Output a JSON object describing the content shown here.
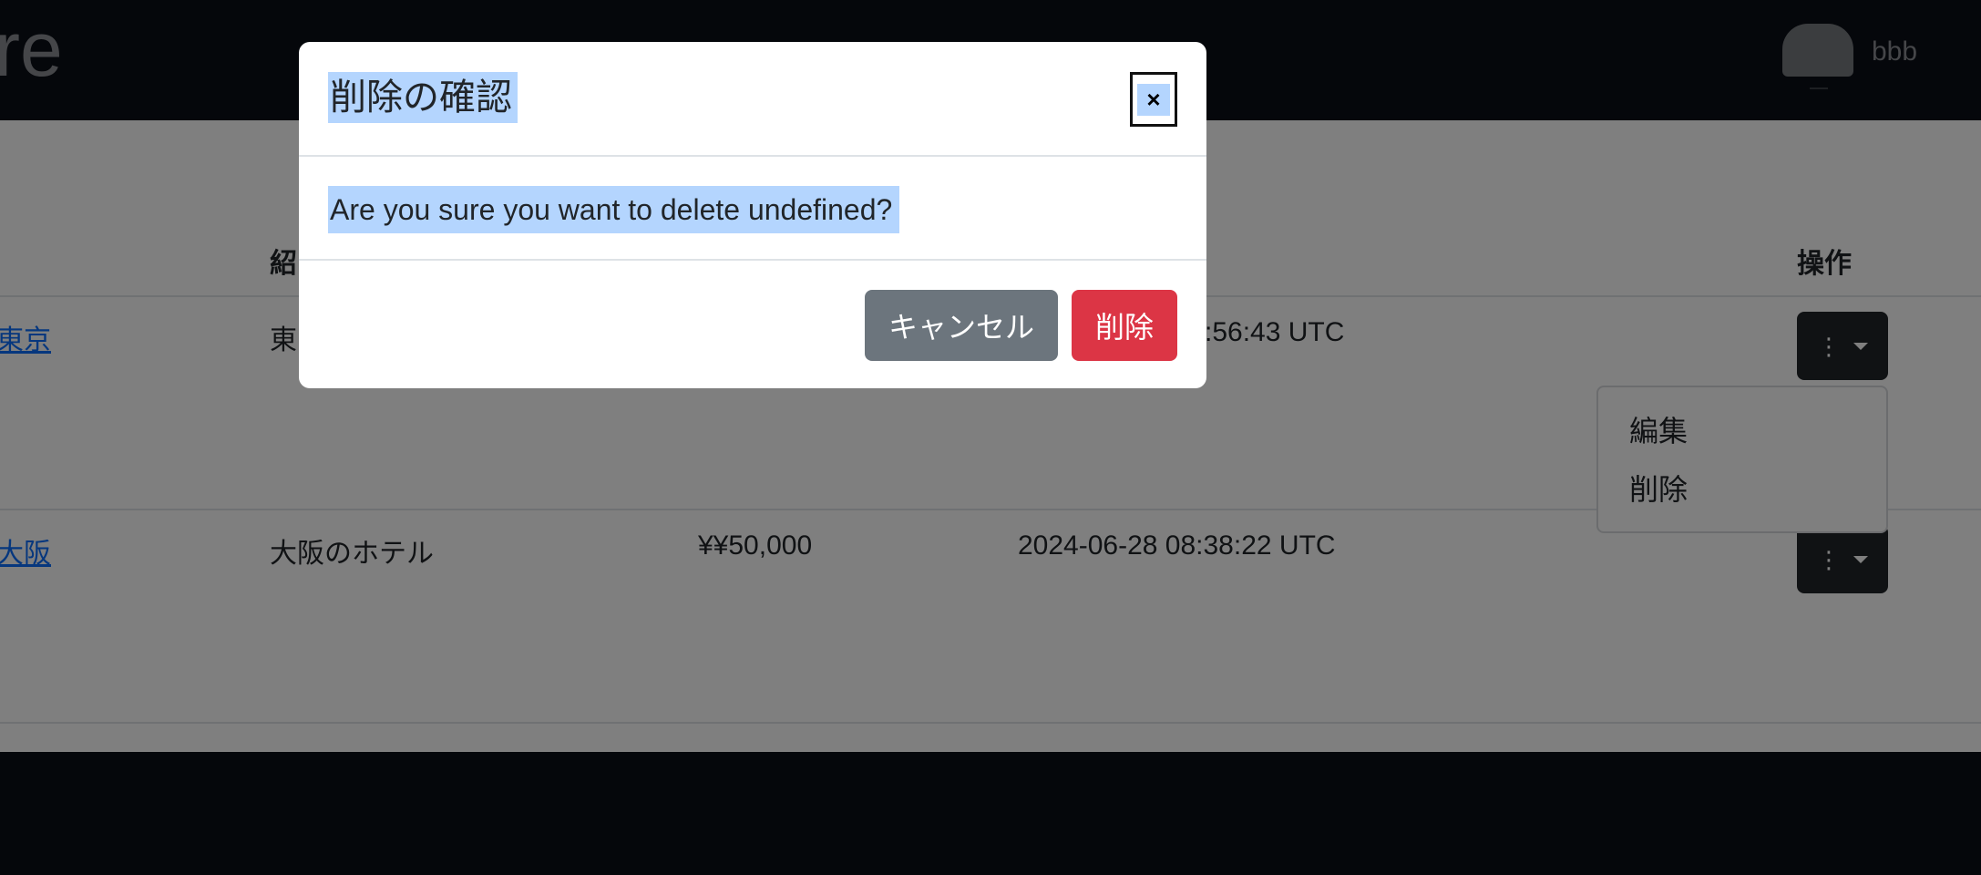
{
  "header": {
    "brand_fragment": "re",
    "username": "bbb"
  },
  "table": {
    "headers": {
      "description": "紹",
      "actions": "操作"
    },
    "rows": [
      {
        "name": "東京",
        "description": "東",
        "created_at": ":56:43 UTC"
      },
      {
        "name": "大阪",
        "description": "大阪のホテル",
        "price": "¥¥50,000",
        "created_at": "2024-06-28 08:38:22 UTC"
      }
    ],
    "action_button": {
      "icon": "kebab-icon",
      "dots": "⋮"
    }
  },
  "dropdown": {
    "items": [
      "編集",
      "削除"
    ]
  },
  "modal": {
    "title": "削除の確認",
    "close_label": "×",
    "message": "Are you sure you want to delete undefined?",
    "cancel_label": "キャンセル",
    "delete_label": "削除"
  },
  "colors": {
    "cancel": "#6c757d",
    "delete": "#dc3545",
    "selection": "#b4d5fe",
    "link": "#0d6efd"
  }
}
